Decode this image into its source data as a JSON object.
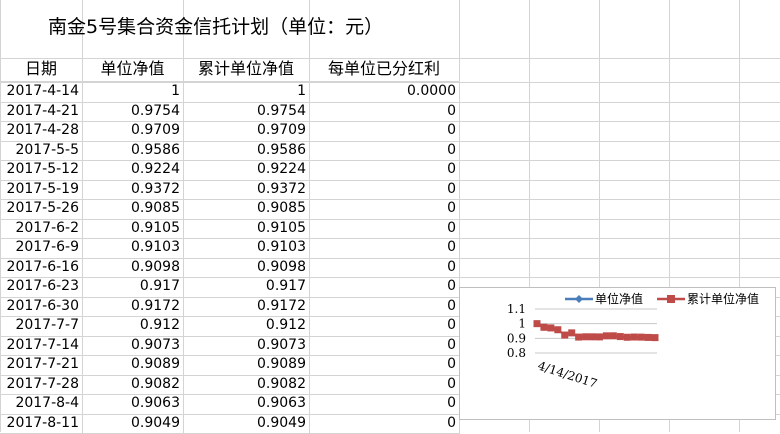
{
  "title": "南金5号集合资金信托计划（单位：元）",
  "headers": [
    "日期",
    "单位净值",
    "累计单位净值",
    "每单位已分红利"
  ],
  "rows": [
    [
      "2017-4-14",
      "1",
      "1",
      "0.0000"
    ],
    [
      "2017-4-21",
      "0.9754",
      "0.9754",
      "0"
    ],
    [
      "2017-4-28",
      "0.9709",
      "0.9709",
      "0"
    ],
    [
      "2017-5-5",
      "0.9586",
      "0.9586",
      "0"
    ],
    [
      "2017-5-12",
      "0.9224",
      "0.9224",
      "0"
    ],
    [
      "2017-5-19",
      "0.9372",
      "0.9372",
      "0"
    ],
    [
      "2017-5-26",
      "0.9085",
      "0.9085",
      "0"
    ],
    [
      "2017-6-2",
      "0.9105",
      "0.9105",
      "0"
    ],
    [
      "2017-6-9",
      "0.9103",
      "0.9103",
      "0"
    ],
    [
      "2017-6-16",
      "0.9098",
      "0.9098",
      "0"
    ],
    [
      "2017-6-23",
      "0.917",
      "0.917",
      "0"
    ],
    [
      "2017-6-30",
      "0.9172",
      "0.9172",
      "0"
    ],
    [
      "2017-7-7",
      "0.912",
      "0.912",
      "0"
    ],
    [
      "2017-7-14",
      "0.9073",
      "0.9073",
      "0"
    ],
    [
      "2017-7-21",
      "0.9089",
      "0.9089",
      "0"
    ],
    [
      "2017-7-28",
      "0.9082",
      "0.9082",
      "0"
    ],
    [
      "2017-8-4",
      "0.9063",
      "0.9063",
      "0"
    ],
    [
      "2017-8-11",
      "0.9049",
      "0.9049",
      "0"
    ]
  ],
  "chart_data": {
    "type": "line",
    "x_tick_label": "4/14/2017",
    "y_ticks": [
      "1.1",
      "1",
      "0.9",
      "0.8"
    ],
    "ylim": [
      0.8,
      1.1
    ],
    "legend_placement": "top",
    "series": [
      {
        "name": "单位净值",
        "color": "#4a7ebb",
        "marker": "diamond",
        "values": [
          1,
          0.9754,
          0.9709,
          0.9586,
          0.9224,
          0.9372,
          0.9085,
          0.9105,
          0.9103,
          0.9098,
          0.917,
          0.9172,
          0.912,
          0.9073,
          0.9089,
          0.9082,
          0.9063,
          0.9049
        ]
      },
      {
        "name": "累计单位净值",
        "color": "#be4b48",
        "marker": "square",
        "values": [
          1,
          0.9754,
          0.9709,
          0.9586,
          0.9224,
          0.9372,
          0.9085,
          0.9105,
          0.9103,
          0.9098,
          0.917,
          0.9172,
          0.912,
          0.9073,
          0.9089,
          0.9082,
          0.9063,
          0.9049
        ]
      }
    ]
  }
}
